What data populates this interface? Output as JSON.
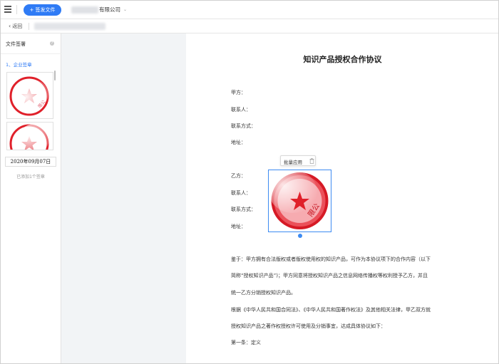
{
  "topbar": {
    "send_button": "+ 签发文件",
    "company_suffix": "有限公司"
  },
  "subbar": {
    "back_label": "返回"
  },
  "left_panel": {
    "title": "文件签署",
    "section_label": "1、企业签章",
    "date_stamp": "2020年09月07日",
    "added_count": "已添加1个签章"
  },
  "document": {
    "title": "知识产品授权合作协议",
    "party_a": {
      "label": "甲方：",
      "contact_label": "联系人：",
      "contact_method_label": "联系方式：",
      "address_label": "地址："
    },
    "party_b": {
      "label": "乙方：",
      "contact_label": "联系人：",
      "contact_method_label": "联系方式：",
      "address_label": "地址："
    },
    "body_lines": [
      "鉴于：甲方拥有合法版权或者版权使用权的知识产品，可作为本协议项下的合作内容（以下",
      "简称“授权知识产品”)；甲方同意将授权知识产品之信息网络传播权等权利授予乙方，并且",
      "统一乙方分销授权知识产品。",
      "根据《中华人民共和国合同法》、《中华人民共和国著作权法》及其他相关法律，甲乙双方就",
      "授权知识产品之著作权授权许可使用及分销事宜，达成具体协议如下：",
      "第一条：定义"
    ]
  },
  "seal_toolbar": {
    "batch_apply": "批量应用"
  },
  "colors": {
    "primary": "#2f7bf5",
    "seal_red": "#e0202a",
    "selection_blue": "#3d8bf2"
  }
}
